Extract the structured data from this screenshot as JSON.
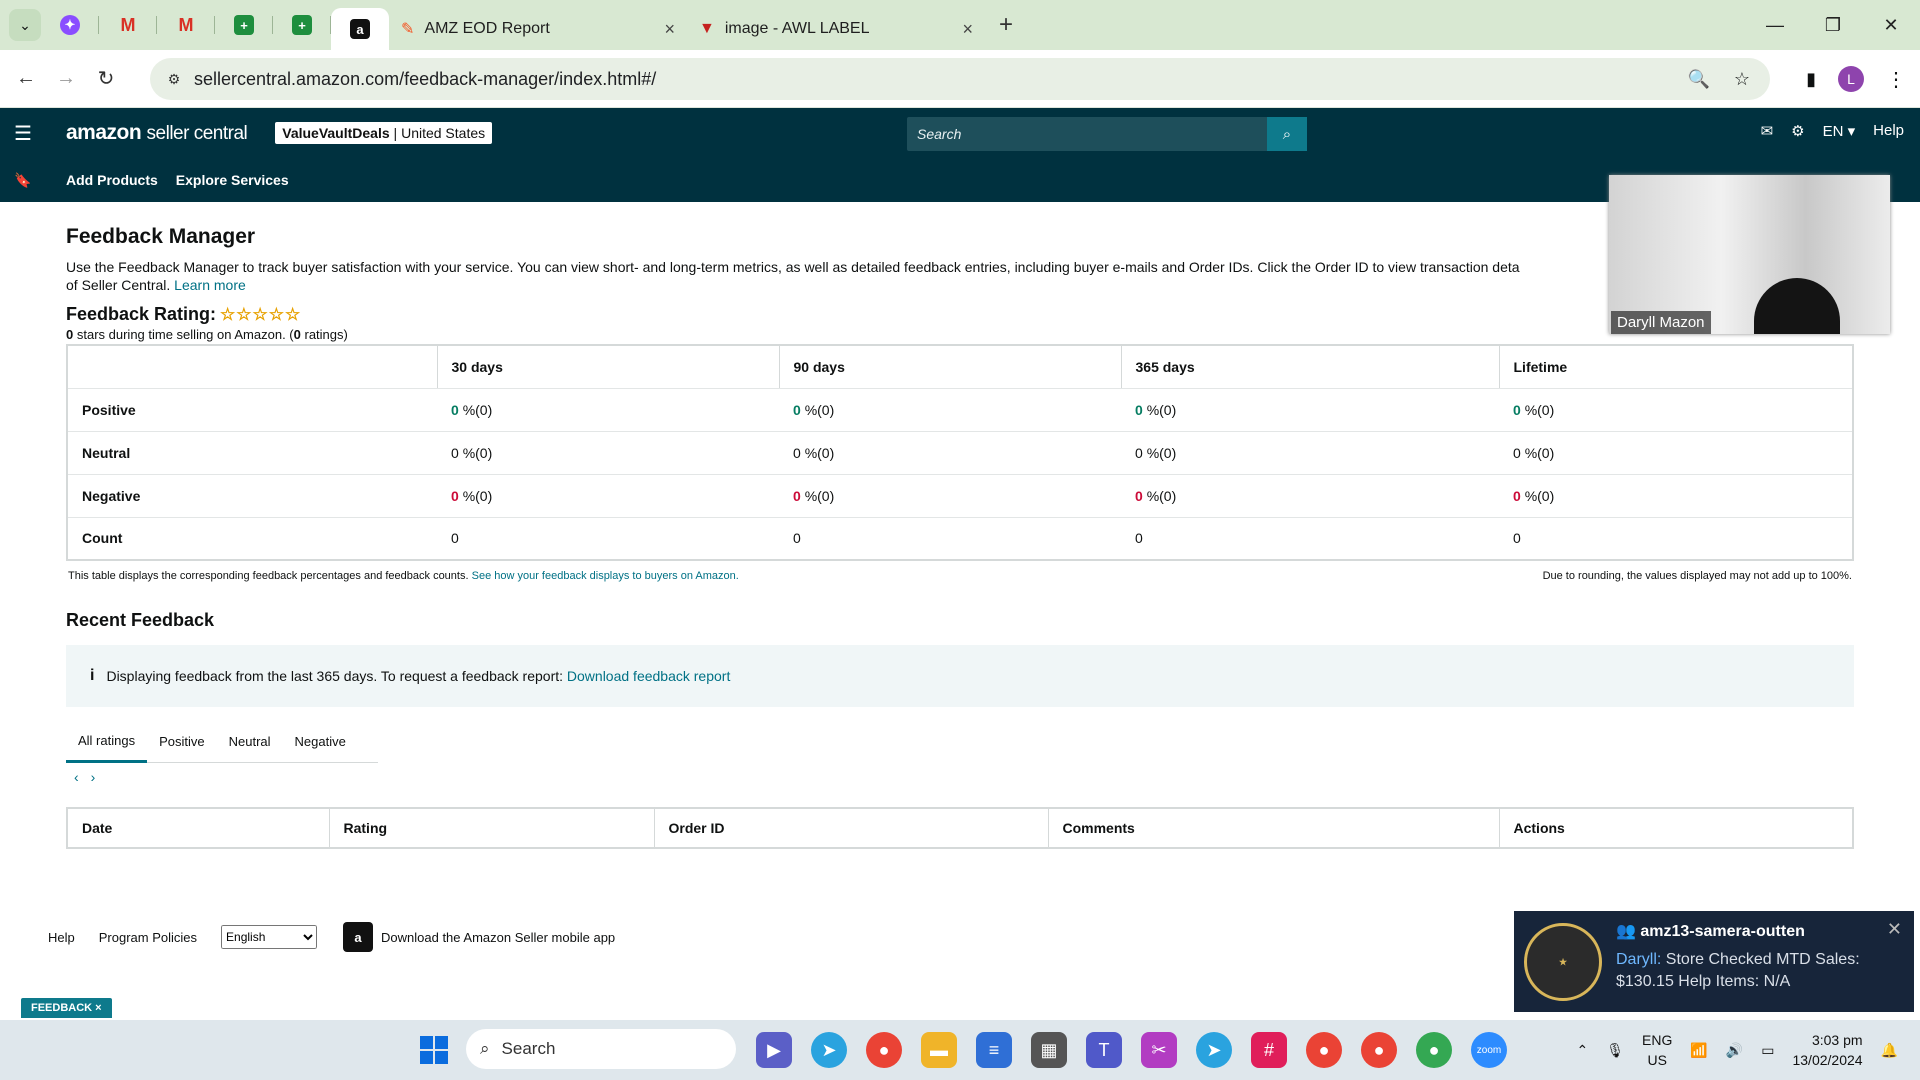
{
  "browser": {
    "tabs": [
      {
        "title": "AMZ EOD Report"
      },
      {
        "title": "image - AWL LABEL"
      }
    ],
    "url": "sellercentral.amazon.com/feedback-manager/index.html#/",
    "profile_initial": "L"
  },
  "header": {
    "logo_amazon": "amazon",
    "logo_suffix": "seller central",
    "store_name": "ValueVaultDeals",
    "store_region": "United States",
    "search_placeholder": "Search",
    "language": "EN",
    "help": "Help",
    "nav": [
      "Add Products",
      "Explore Services"
    ]
  },
  "page": {
    "title": "Feedback Manager",
    "intro": "Use the Feedback Manager to track buyer satisfaction with your service. You can view short- and long-term metrics, as well as detailed feedback entries, including buyer e-mails and Order IDs. Click the Order ID to view transaction deta",
    "intro_line2": "of Seller Central.",
    "learn_more": "Learn more",
    "rating_title": "Feedback Rating:",
    "stars_value": "0",
    "stars_text": "stars during time selling on Amazon. (",
    "ratings_count": "0",
    "ratings_suffix": "ratings)",
    "table": {
      "columns": [
        "30 days",
        "90 days",
        "365 days",
        "Lifetime"
      ],
      "rows": [
        {
          "label": "Positive",
          "values": [
            "0",
            "0",
            "0",
            "0"
          ],
          "suffix": "%(0)"
        },
        {
          "label": "Neutral",
          "values": [
            "0",
            "0",
            "0",
            "0"
          ],
          "suffix": "%(0)"
        },
        {
          "label": "Negative",
          "values": [
            "0",
            "0",
            "0",
            "0"
          ],
          "suffix": "%(0)"
        },
        {
          "label": "Count",
          "values": [
            "0",
            "0",
            "0",
            "0"
          ]
        }
      ]
    },
    "note_left": "This table displays the corresponding feedback percentages and feedback counts.",
    "note_link": "See how your feedback displays to buyers on Amazon.",
    "note_right": "Due to rounding, the values displayed may not add up to 100%.",
    "recent_title": "Recent Feedback",
    "info_text": "Displaying feedback from the last 365 days. To request a feedback report:",
    "info_link": "Download feedback report",
    "filter_tabs": [
      "All ratings",
      "Positive",
      "Neutral",
      "Negative"
    ],
    "recent_columns": [
      "Date",
      "Rating",
      "Order ID",
      "Comments",
      "Actions"
    ]
  },
  "footer": {
    "help": "Help",
    "policies": "Program Policies",
    "language": "English",
    "app": "Download the Amazon Seller mobile app",
    "feedback_tag": "FEEDBACK ×"
  },
  "video": {
    "name": "Daryll Mazon"
  },
  "notification": {
    "title": "amz13-samera-outten",
    "sender": "Daryll:",
    "message": "Store Checked MTD Sales: $130.15 Help Items: N/A"
  },
  "taskbar": {
    "search": "Search",
    "lang1": "ENG",
    "lang2": "US",
    "time": "3:03 pm",
    "date": "13/02/2024"
  }
}
